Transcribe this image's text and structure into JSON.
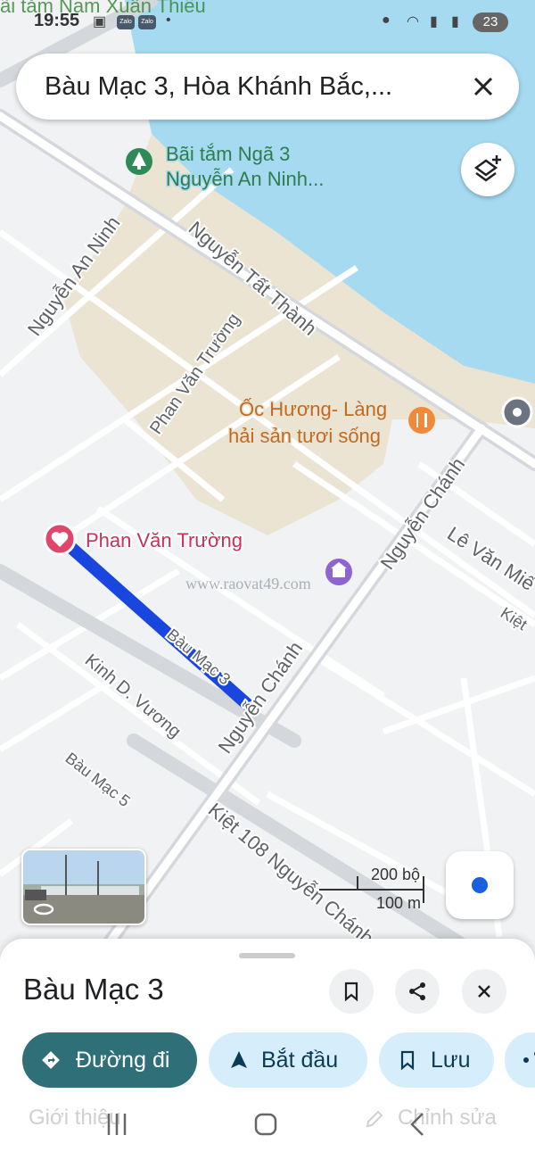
{
  "status_bar": {
    "faded_overlay_text": "ãi tắm Nam Xuân Thiều",
    "time": "19:55",
    "app_badge_1": "Zalo",
    "app_badge_2": "Zalo",
    "battery": "23"
  },
  "search": {
    "query": "Bàu Mạc 3, Hòa Khánh Bắc,..."
  },
  "map": {
    "poi_beach_line1": "Bãi tắm Ngã 3",
    "poi_beach_line2": "Nguyễn An Ninh...",
    "poi_restaurant_line1": "Ốc Hương- Làng",
    "poi_restaurant_line2": "hải sản tươi sống",
    "pin_label": "Phan Văn Trường",
    "watermark": "www.raovat49.com",
    "street_labels": [
      "Nguyễn An Ninh",
      "Nguyễn Tất Thành",
      "Phan Văn Trường",
      "Nguyễn Chánh",
      "Lê Văn Miế",
      "Kiệt",
      "Bàu Mạc 3",
      "Kinh D. Vương",
      "Nguyễn Chánh",
      "Bàu Mạc 5",
      "Kiệt 108 Nguyễn Chánh"
    ],
    "scale_imperial": "200 bộ",
    "scale_metric": "100 m",
    "colors": {
      "water": "#a5daf1",
      "land_park": "#ebe4d3",
      "road": "#ffffff",
      "major_road": "#d4d7dc",
      "route": "#1a46e0",
      "pin": "#e0456a"
    }
  },
  "sheet": {
    "title": "Bàu Mạc 3",
    "buttons": {
      "directions": "Đường đi",
      "start": "Bắt đầu",
      "save": "Lưu"
    },
    "tabs": {
      "about": "Giới thiệu",
      "edit": "Chỉnh sửa"
    }
  }
}
